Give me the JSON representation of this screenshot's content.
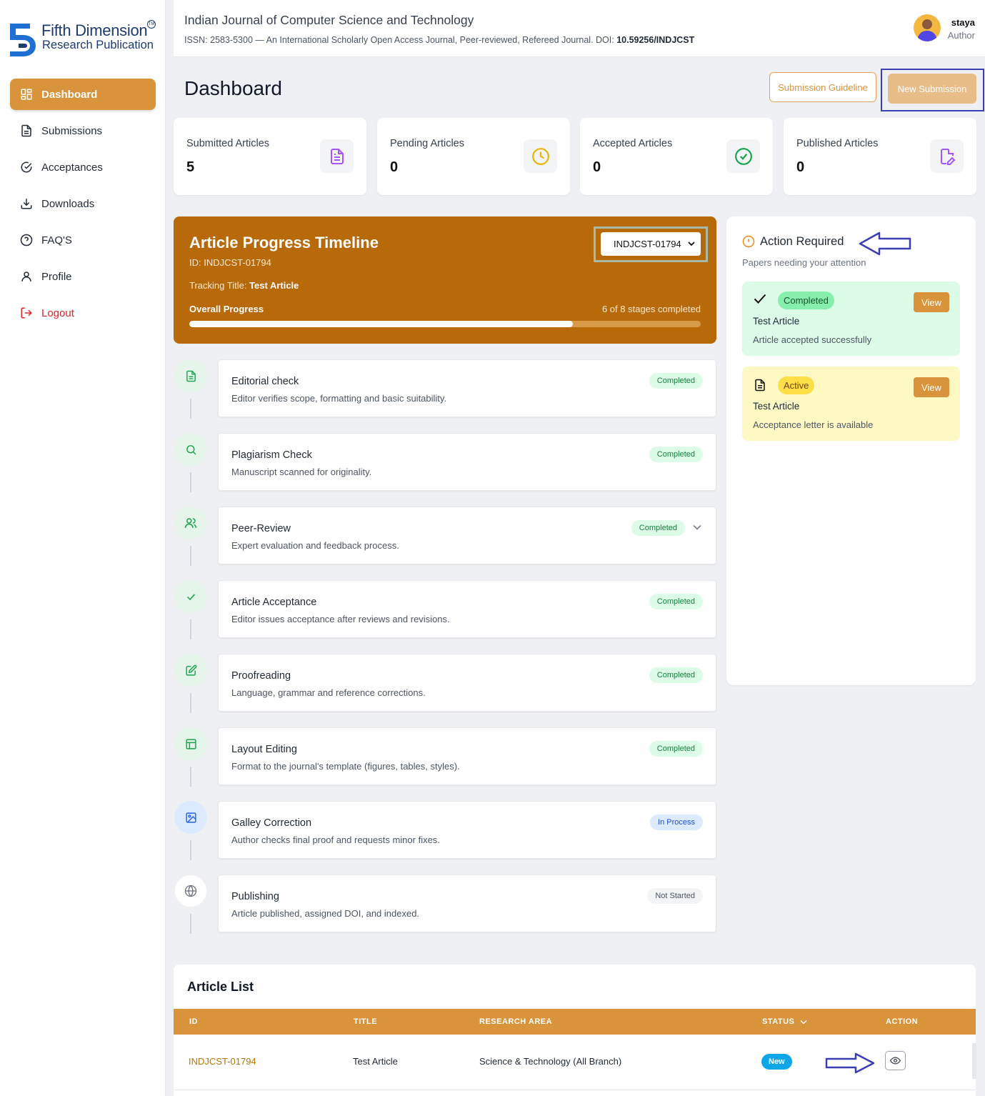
{
  "brand": {
    "name": "Fifth Dimension",
    "sub": "Research Publication",
    "tm": "TM"
  },
  "nav": [
    {
      "label": "Dashboard",
      "icon": "dashboard-icon",
      "active": true
    },
    {
      "label": "Submissions",
      "icon": "document-icon"
    },
    {
      "label": "Acceptances",
      "icon": "check-circle-icon"
    },
    {
      "label": "Downloads",
      "icon": "download-icon"
    },
    {
      "label": "FAQ'S",
      "icon": "question-icon"
    },
    {
      "label": "Profile",
      "icon": "user-icon"
    },
    {
      "label": "Logout",
      "icon": "logout-icon"
    }
  ],
  "header": {
    "title": "Indian Journal of Computer Science and Technology",
    "subtitle": "ISSN: 2583-5300 — An International Scholarly Open Access Journal, Peer-reviewed, Refereed Journal. DOI: ",
    "doi": "10.59256/INDJCST",
    "user_name": "staya",
    "user_role": "Author"
  },
  "page": {
    "title": "Dashboard",
    "guideline_button": "Submission Guideline",
    "new_button": "New Submission"
  },
  "stats": [
    {
      "label": "Submitted Articles",
      "value": "5",
      "icon": "document-icon",
      "color": "#a855f7"
    },
    {
      "label": "Pending Articles",
      "value": "0",
      "icon": "clock-icon",
      "color": "#eab308"
    },
    {
      "label": "Accepted Articles",
      "value": "0",
      "icon": "check-circle-icon",
      "color": "#16a34a"
    },
    {
      "label": "Published Articles",
      "value": "0",
      "icon": "edit-document-icon",
      "color": "#a855f7"
    }
  ],
  "timeline": {
    "title": "Article Progress Timeline",
    "id_text": "ID: INDJCST-01794",
    "tracking_label": "Tracking Title: ",
    "tracking_title": "Test Article",
    "overall_label": "Overall Progress",
    "stages_text": "6 of 8 stages completed",
    "progress": 0.75,
    "selected_article": "INDJCST-01794"
  },
  "stages": [
    {
      "name": "Editorial check",
      "desc": "Editor verifies scope, formatting and basic suitability.",
      "status": "Completed",
      "icon": "document-icon"
    },
    {
      "name": "Plagiarism Check",
      "desc": "Manuscript scanned for originality.",
      "status": "Completed",
      "icon": "search-icon"
    },
    {
      "name": "Peer-Review",
      "desc": "Expert evaluation and feedback process.",
      "status": "Completed",
      "icon": "users-icon"
    },
    {
      "name": "Article Acceptance",
      "desc": "Editor issues acceptance after reviews and revisions.",
      "status": "Completed",
      "icon": "check-icon"
    },
    {
      "name": "Proofreading",
      "desc": "Language, grammar and reference corrections.",
      "status": "Completed",
      "icon": "edit-icon"
    },
    {
      "name": "Layout Editing",
      "desc": "Format to the journal's template (figures, tables, styles).",
      "status": "Completed",
      "icon": "layout-icon"
    },
    {
      "name": "Galley Correction",
      "desc": "Author checks final proof and requests minor fixes.",
      "status": "In Process",
      "icon": "image-icon"
    },
    {
      "name": "Publishing",
      "desc": "Article published, assigned DOI, and indexed.",
      "status": "Not Started",
      "icon": "globe-icon"
    }
  ],
  "action": {
    "title": "Action Required",
    "subtitle": "Papers needing your attention",
    "items": [
      {
        "badge": "Completed",
        "name": "Test Article",
        "desc": "Article accepted successfully",
        "button": "View"
      },
      {
        "badge": "Active",
        "name": "Test Article",
        "desc": "Acceptance letter is available",
        "button": "View"
      }
    ]
  },
  "article_list": {
    "title": "Article List",
    "columns": [
      "ID",
      "TITLE",
      "RESEARCH AREA",
      "STATUS",
      "ACTION"
    ],
    "rows": [
      {
        "id": "INDJCST-01794",
        "title": "Test Article",
        "area": "Science & Technology (All Branch)",
        "status": "New"
      }
    ]
  },
  "colors": {
    "accent": "#d9933a",
    "banner": "#b8690a",
    "annotation": "#3a3fb3"
  }
}
